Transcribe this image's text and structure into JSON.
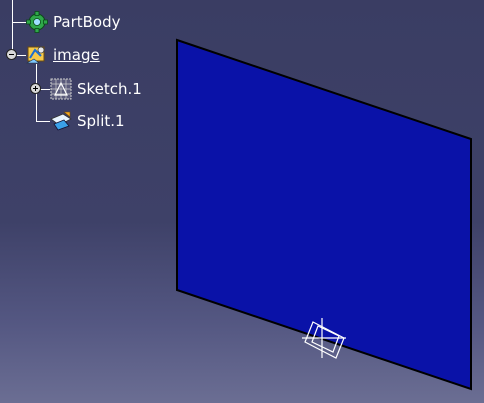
{
  "tree": {
    "items": [
      {
        "label": "PartBody",
        "icon": "partbody-gear-icon"
      },
      {
        "label": "image",
        "icon": "geometrical-set-icon",
        "expander": "minus"
      },
      {
        "label": "Sketch.1",
        "icon": "sketch-icon",
        "expander": "plus"
      },
      {
        "label": "Split.1",
        "icon": "split-icon"
      }
    ]
  },
  "scene": {
    "surface_color": "#0a12a8",
    "edge_color": "#000000",
    "axis_color": "#ffffff"
  }
}
